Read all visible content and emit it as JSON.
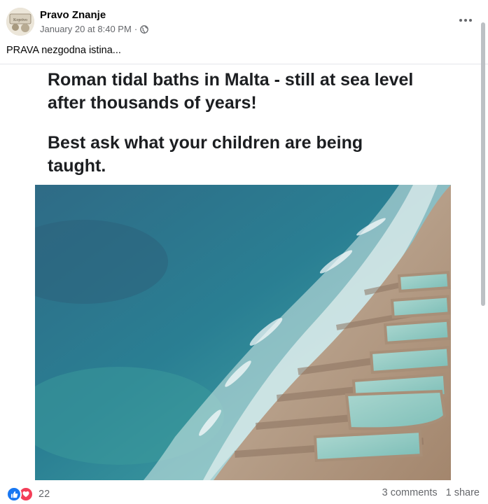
{
  "post": {
    "page_name": "Pravo Znanje",
    "date": "January 20 at 8:40 PM",
    "separator": "·",
    "privacy_icon": "globe-icon",
    "more_icon": "more-options-icon",
    "avatar_text": "Koprivo",
    "caption": "PRAVA nezgodna istina...",
    "image": {
      "headline": "Roman tidal baths in Malta - still at sea level\nafter thousands of years!",
      "subline": "Best ask what your children are being\ntaught.",
      "photo_description_icon": "aerial-coast-photo"
    },
    "footer": {
      "reaction_icons": [
        "like-icon",
        "love-icon"
      ],
      "reaction_count": "22",
      "comments": "3 comments",
      "shares": "1 share"
    }
  },
  "colors": {
    "like": "#1877f2",
    "love": "#f33e58",
    "meta_text": "#65676b",
    "primary_text": "#050505"
  }
}
